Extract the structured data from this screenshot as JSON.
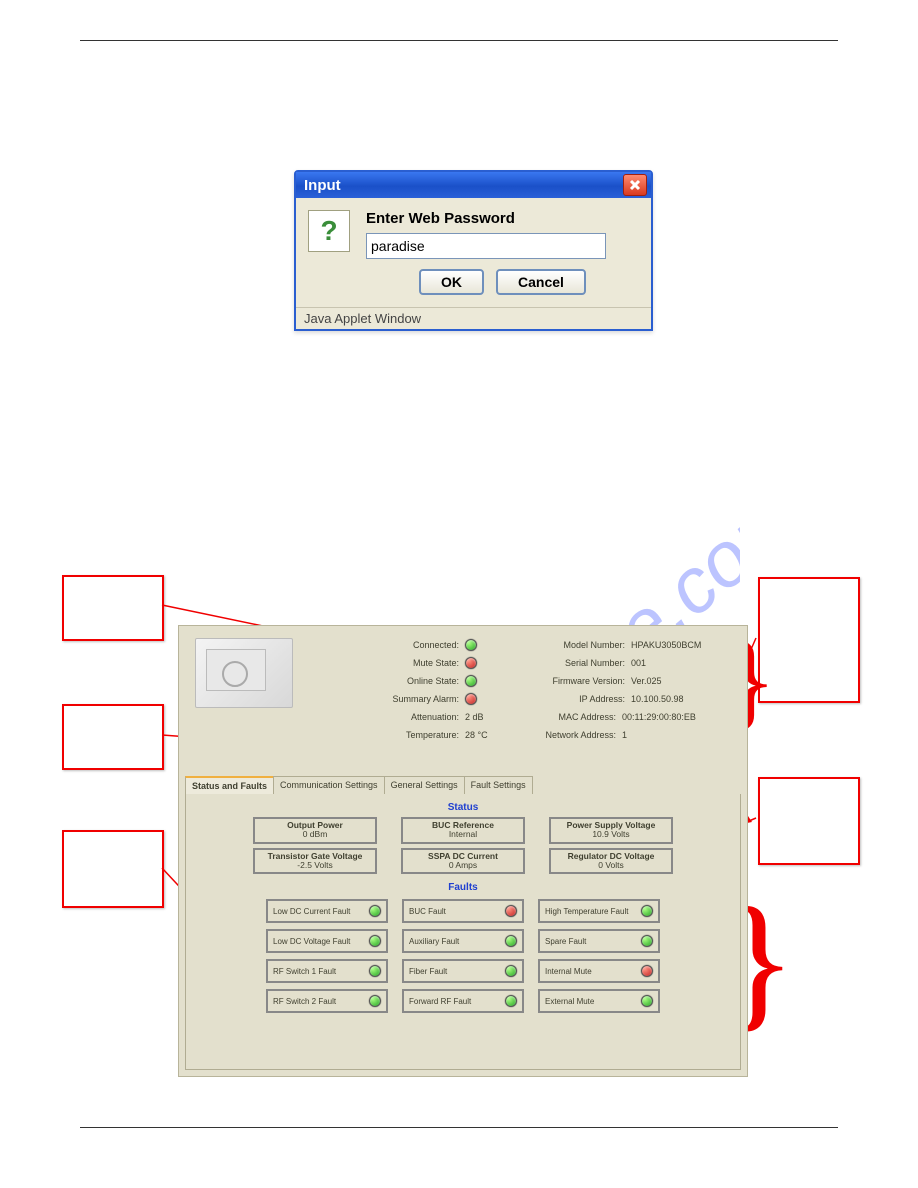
{
  "dialog": {
    "title": "Input",
    "prompt": "Enter Web Password",
    "input_value": "paradise",
    "ok": "OK",
    "cancel": "Cancel",
    "footer": "Java Applet Window"
  },
  "panel": {
    "status_labels": {
      "connected": "Connected:",
      "mute": "Mute State:",
      "online": "Online State:",
      "alarm": "Summary Alarm:",
      "atten": "Attenuation:",
      "temp": "Temperature:"
    },
    "status_values": {
      "atten": "2 dB",
      "temp": "28 °C"
    },
    "info_labels": {
      "model": "Model Number:",
      "serial": "Serial Number:",
      "firmware": "Firmware Version:",
      "ip": "IP Address:",
      "mac": "MAC Address:",
      "net": "Network Address:"
    },
    "info_values": {
      "model": "HPAKU3050BCM",
      "serial": "001",
      "firmware": "Ver.025",
      "ip": "10.100.50.98",
      "mac": "00:11:29:00:80:EB",
      "net": "1"
    },
    "tabs": [
      "Status and Faults",
      "Communication Settings",
      "General Settings",
      "Fault Settings"
    ],
    "section_status": "Status",
    "section_faults": "Faults",
    "boxes_row1": [
      {
        "h": "Output Power",
        "v": "0 dBm"
      },
      {
        "h": "BUC Reference",
        "v": "Internal"
      },
      {
        "h": "Power Supply Voltage",
        "v": "10.9 Volts"
      }
    ],
    "boxes_row2": [
      {
        "h": "Transistor Gate Voltage",
        "v": "-2.5 Volts"
      },
      {
        "h": "SSPA DC Current",
        "v": "0 Amps"
      },
      {
        "h": "Regulator DC Voltage",
        "v": "0 Volts"
      }
    ],
    "faults": {
      "col1": [
        {
          "n": "Low DC Current Fault",
          "c": "green"
        },
        {
          "n": "Low DC Voltage Fault",
          "c": "green"
        },
        {
          "n": "RF Switch 1 Fault",
          "c": "green"
        },
        {
          "n": "RF Switch 2 Fault",
          "c": "green"
        }
      ],
      "col2": [
        {
          "n": "BUC Fault",
          "c": "red"
        },
        {
          "n": "Auxiliary Fault",
          "c": "green"
        },
        {
          "n": "Fiber Fault",
          "c": "green"
        },
        {
          "n": "Forward RF Fault",
          "c": "green"
        }
      ],
      "col3": [
        {
          "n": "High Temperature Fault",
          "c": "green"
        },
        {
          "n": "Spare Fault",
          "c": "green"
        },
        {
          "n": "Internal Mute",
          "c": "red"
        },
        {
          "n": "External Mute",
          "c": "green"
        }
      ]
    }
  }
}
